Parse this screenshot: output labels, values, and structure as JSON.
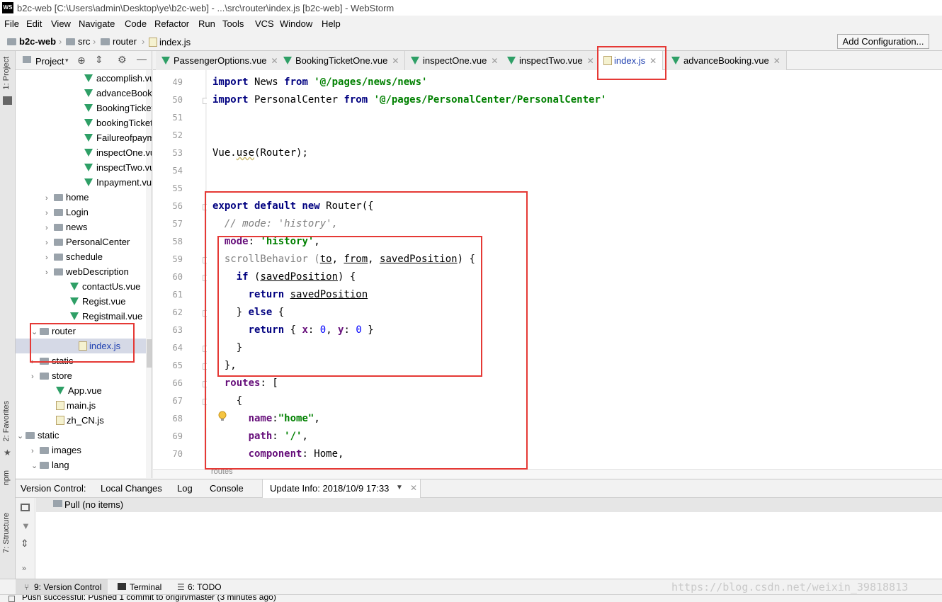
{
  "window": {
    "title": "b2c-web [C:\\Users\\admin\\Desktop\\ye\\b2c-web] - ...\\src\\router\\index.js [b2c-web] - WebStorm",
    "logo": "WS"
  },
  "menu": [
    "File",
    "Edit",
    "View",
    "Navigate",
    "Code",
    "Refactor",
    "Run",
    "Tools",
    "VCS",
    "Window",
    "Help"
  ],
  "breadcrumb": [
    "b2c-web",
    "src",
    "router",
    "index.js"
  ],
  "toolbar": {
    "add_configuration": "Add Configuration..."
  },
  "left_strip": {
    "project": "1: Project",
    "favorites": "2: Favorites",
    "npm": "npm",
    "structure": "7: Structure"
  },
  "project_panel": {
    "title": "Project",
    "rows": [
      {
        "label": "accomplish.vue",
        "type": "vue"
      },
      {
        "label": "advanceBooking.vue",
        "type": "vue"
      },
      {
        "label": "BookingTicketOne.vue",
        "type": "vue"
      },
      {
        "label": "bookingTicketTwo.vue",
        "type": "vue"
      },
      {
        "label": "Failureofpayment.vue",
        "type": "vue"
      },
      {
        "label": "inspectOne.vue",
        "type": "vue"
      },
      {
        "label": "inspectTwo.vue",
        "type": "vue"
      },
      {
        "label": "Inpayment.vue",
        "type": "vue"
      },
      {
        "label": "home",
        "type": "folder"
      },
      {
        "label": "Login",
        "type": "folder"
      },
      {
        "label": "news",
        "type": "folder"
      },
      {
        "label": "PersonalCenter",
        "type": "folder"
      },
      {
        "label": "schedule",
        "type": "folder"
      },
      {
        "label": "webDescription",
        "type": "folder"
      },
      {
        "label": "contactUs.vue",
        "type": "vue"
      },
      {
        "label": "Regist.vue",
        "type": "vue"
      },
      {
        "label": "Registmail.vue",
        "type": "vue"
      },
      {
        "label": "router",
        "type": "folder"
      },
      {
        "label": "index.js",
        "type": "js"
      },
      {
        "label": "static",
        "type": "folder"
      },
      {
        "label": "store",
        "type": "folder"
      },
      {
        "label": "App.vue",
        "type": "vue"
      },
      {
        "label": "main.js",
        "type": "js"
      },
      {
        "label": "zh_CN.js",
        "type": "js"
      },
      {
        "label": "static",
        "type": "folder"
      },
      {
        "label": "images",
        "type": "folder"
      },
      {
        "label": "lang",
        "type": "folder"
      }
    ]
  },
  "editor_tabs": [
    {
      "label": "PassengerOptions.vue",
      "type": "vue"
    },
    {
      "label": "BookingTicketOne.vue",
      "type": "vue"
    },
    {
      "label": "inspectOne.vue",
      "type": "vue"
    },
    {
      "label": "inspectTwo.vue",
      "type": "vue"
    },
    {
      "label": "index.js",
      "type": "js",
      "active": true
    },
    {
      "label": "advanceBooking.vue",
      "type": "vue"
    }
  ],
  "line_numbers": [
    "49",
    "50",
    "51",
    "52",
    "53",
    "54",
    "55",
    "56",
    "57",
    "58",
    "59",
    "60",
    "61",
    "62",
    "63",
    "64",
    "65",
    "66",
    "67",
    "68",
    "69",
    "70"
  ],
  "code": {
    "l49a": "import",
    "l49b": " News ",
    "l49c": "from",
    "l49d": " '@/pages/news/news'",
    "l50a": "import",
    "l50b": " PersonalCenter ",
    "l50c": "from",
    "l50d": " '@/pages/PersonalCenter/PersonalCenter'",
    "l53a": "Vue.",
    "l53b": "use",
    "l53c": "(Router);",
    "l56a": "export default new",
    "l56b": " Router({",
    "l57": "  // mode: 'history',",
    "l58a": "  mode",
    "l58b": ": ",
    "l58c": "'history'",
    "l58d": ",",
    "l59a": "  scrollBehavior (",
    "l59b": "to",
    "l59c": ", ",
    "l59d": "from",
    "l59e": ", ",
    "l59f": "savedPosition",
    "l59g": ") {",
    "l60a": "    if",
    "l60b": " (",
    "l60c": "savedPosition",
    "l60d": ") {",
    "l61a": "      return",
    "l61b": " ",
    "l61c": "savedPosition",
    "l62a": "    } ",
    "l62b": "else",
    "l62c": " {",
    "l63a": "      return",
    "l63b": " { ",
    "l63c": "x",
    "l63d": ": ",
    "l63e": "0",
    "l63f": ", ",
    "l63g": "y",
    "l63h": ": ",
    "l63i": "0",
    "l63j": " }",
    "l64": "    }",
    "l65": "  },",
    "l66a": "  routes",
    "l66b": ": [",
    "l67": "    {",
    "l68a": "      name",
    "l68b": ":",
    "l68c": "\"home\"",
    "l68d": ",",
    "l69a": "      path",
    "l69b": ": ",
    "l69c": "'/'",
    "l69d": ",",
    "l70a": "      component",
    "l70b": ": Home,"
  },
  "editor_footer": "routes",
  "version_control": {
    "label": "Version Control:",
    "tabs": [
      "Local Changes",
      "Log",
      "Console"
    ],
    "update_info": "Update Info: 2018/10/9 17:33",
    "row": "Pull (no items)"
  },
  "bottom_tabs": [
    "9: Version Control",
    "Terminal",
    "6: TODO"
  ],
  "status": "Push successful: Pushed 1 commit to origin/master (3 minutes ago)",
  "watermark": "https://blog.csdn.net/weixin_39818813",
  "colors": {
    "annotation_red": "#e53935",
    "keyword": "#000080",
    "string": "#008000",
    "property": "#660e7a"
  }
}
